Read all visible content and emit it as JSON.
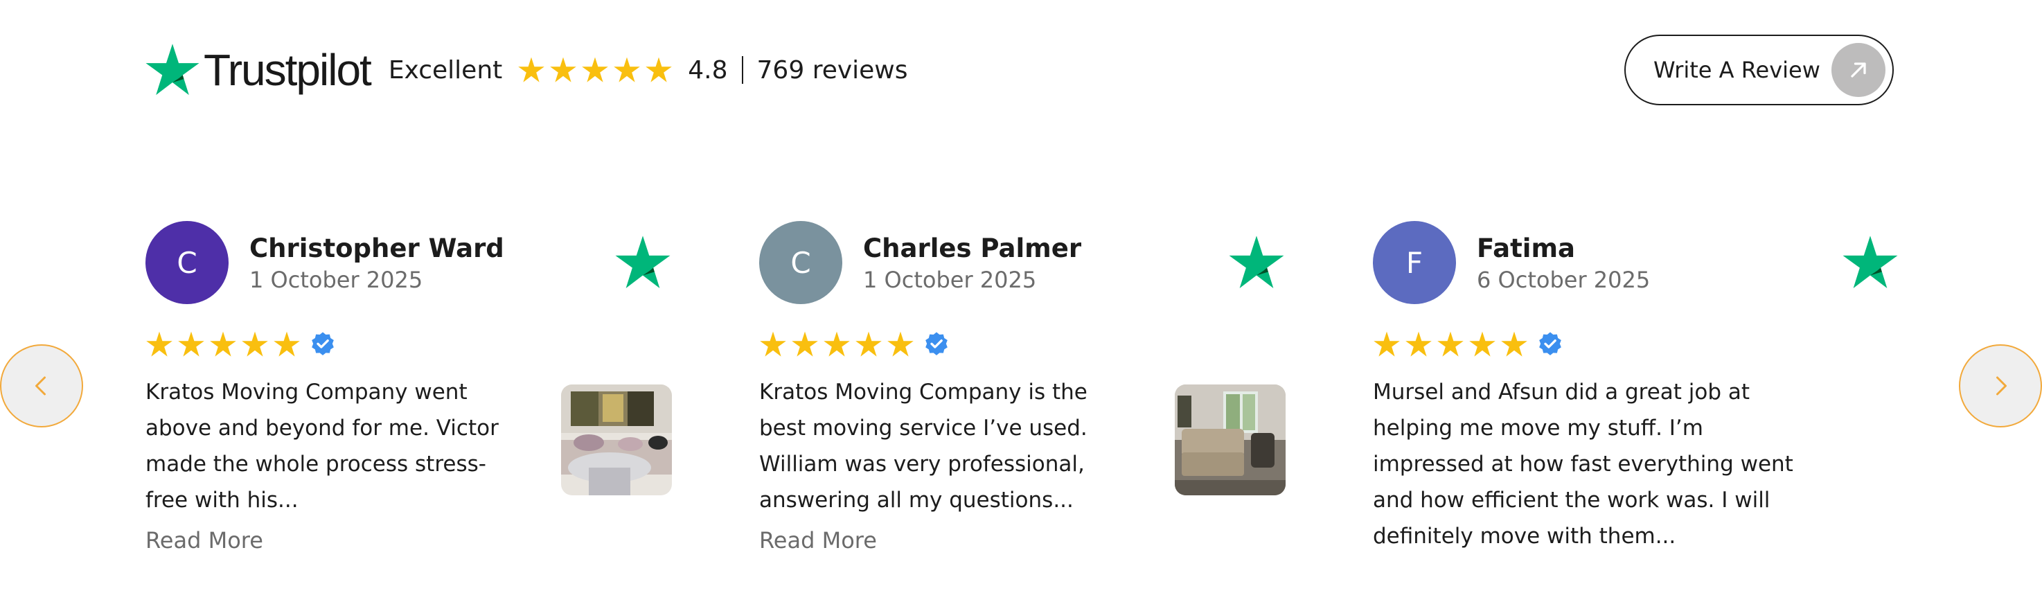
{
  "header": {
    "brand": "Trustpilot",
    "rating_word": "Excellent",
    "rating_value": "4.8",
    "review_count": "769 reviews",
    "stars_filled": 5,
    "write_review_label": "Write A Review"
  },
  "colors": {
    "trustpilot_green": "#00b67a",
    "star_yellow": "#f9bf0f",
    "verified_blue": "#3b8fef",
    "nav_border": "#f2a93b"
  },
  "icons": {
    "nav_prev": "chevron-left-icon",
    "nav_next": "chevron-right-icon",
    "write_review": "arrow-up-right-icon",
    "verified": "verified-badge-icon"
  },
  "reviews": [
    {
      "initial": "C",
      "avatar_color": "#4e2fa8",
      "name": "Christopher Ward",
      "date": "1 October 2025",
      "stars": 5,
      "text": "Kratos Moving Company went above and beyond for me. Victor made the whole process stress-free with his...",
      "read_more": "Read More",
      "has_photo": true
    },
    {
      "initial": "C",
      "avatar_color": "#7a929e",
      "name": "Charles Palmer",
      "date": "1 October 2025",
      "stars": 5,
      "text": "Kratos Moving Company is the best moving service I’ve used. William was very professional, answering all my questions...",
      "read_more": "Read More",
      "has_photo": true
    },
    {
      "initial": "F",
      "avatar_color": "#5c6bc0",
      "name": "Fatima",
      "date": "6 October 2025",
      "stars": 5,
      "text": "Mursel and Afsun did a great job at helping me move my stuff. I’m impressed at how fast everything went and how efficient the work was. I will definitely move with them...",
      "has_photo": false
    }
  ]
}
